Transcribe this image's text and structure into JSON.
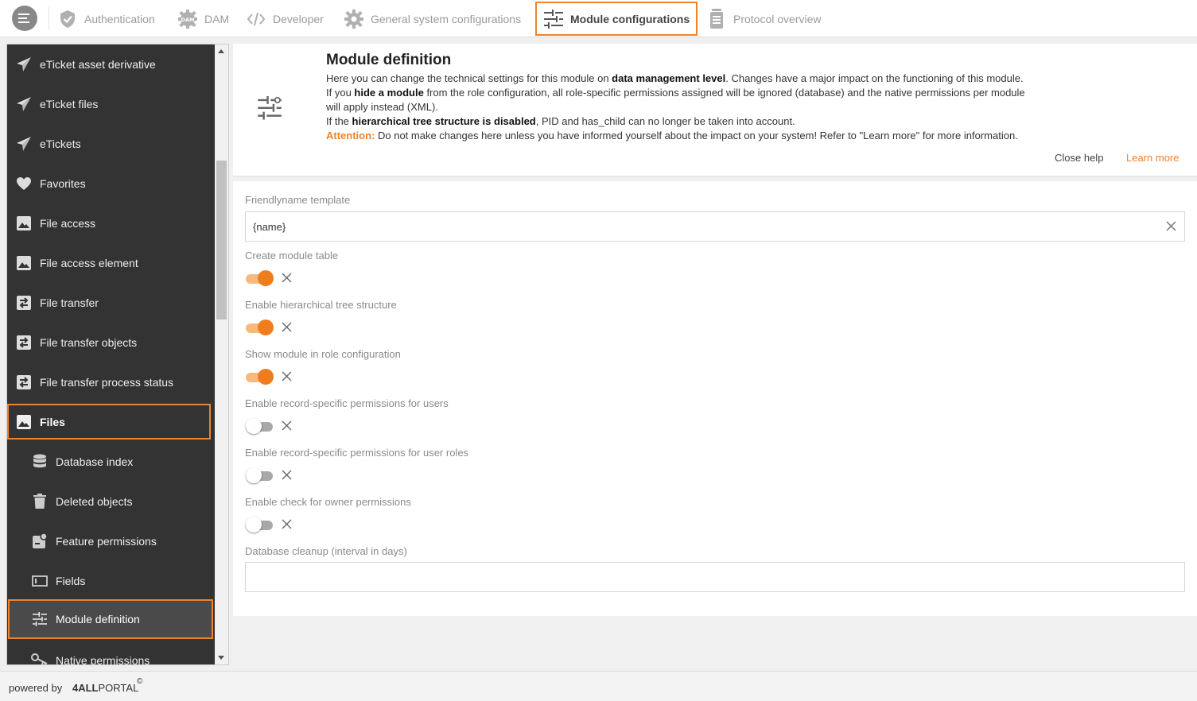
{
  "topbar": {
    "tabs": [
      {
        "label": "Authentication",
        "icon": "shield-check-icon"
      },
      {
        "label": "DAM",
        "icon": "dam-gear-icon"
      },
      {
        "label": "Developer",
        "icon": "code-icon"
      },
      {
        "label": "General system configurations",
        "icon": "gear-icon"
      },
      {
        "label": "Module configurations",
        "icon": "sliders-icon",
        "active": true
      },
      {
        "label": "Protocol overview",
        "icon": "document-stack-icon"
      }
    ]
  },
  "sidebar": {
    "items": [
      {
        "label": "eTicket asset derivative",
        "icon": "paper-plane-icon"
      },
      {
        "label": "eTicket files",
        "icon": "paper-plane-icon"
      },
      {
        "label": "eTickets",
        "icon": "paper-plane-icon"
      },
      {
        "label": "Favorites",
        "icon": "heart-icon"
      },
      {
        "label": "File access",
        "icon": "image-icon"
      },
      {
        "label": "File access element",
        "icon": "image-icon"
      },
      {
        "label": "File transfer",
        "icon": "transfer-icon"
      },
      {
        "label": "File transfer objects",
        "icon": "transfer-icon"
      },
      {
        "label": "File transfer process status",
        "icon": "transfer-icon"
      },
      {
        "label": "Files",
        "icon": "image-icon",
        "highlighted": true
      },
      {
        "label": "Database index",
        "icon": "database-icon",
        "sub": true
      },
      {
        "label": "Deleted objects",
        "icon": "trash-icon",
        "sub": true
      },
      {
        "label": "Feature permissions",
        "icon": "feature-permissions-icon",
        "sub": true
      },
      {
        "label": "Fields",
        "icon": "fields-icon",
        "sub": true
      },
      {
        "label": "Module definition",
        "icon": "sliders-icon",
        "sub": true,
        "selected": true
      },
      {
        "label": "Native permissions",
        "icon": "key-icon",
        "sub": true
      }
    ]
  },
  "help": {
    "title": "Module definition",
    "line1_a": "Here you can change the technical settings for this module on ",
    "line1_b": "data management level",
    "line1_c": ". Changes have a major impact on the functioning of this module.",
    "line2_a": "If you ",
    "line2_b": "hide a module",
    "line2_c": " from the role configuration, all role-specific permissions assigned will be ignored (database) and the native permissions per module will apply instead (XML).",
    "line3_a": "If the ",
    "line3_b": "hierarchical tree structure is disabled",
    "line3_c": ", PID and has_child can no longer be taken into account.",
    "attention_label": "Attention:",
    "attention_text": " Do not make changes here unless you have informed yourself about the impact on your system! Refer to \"Learn more\" for more information.",
    "close_label": "Close help",
    "learn_more_label": "Learn more"
  },
  "form": {
    "friendlyname_label": "Friendlyname template",
    "friendlyname_value": "{name}",
    "toggles": [
      {
        "label": "Create module table",
        "on": true
      },
      {
        "label": "Enable hierarchical tree structure",
        "on": true
      },
      {
        "label": "Show module in role configuration",
        "on": true
      },
      {
        "label": "Enable record-specific permissions for users",
        "on": false
      },
      {
        "label": "Enable record-specific permissions for user roles",
        "on": false
      },
      {
        "label": "Enable check for owner permissions",
        "on": false
      }
    ],
    "cleanup_label": "Database cleanup (interval in days)",
    "cleanup_value": ""
  },
  "footer": {
    "powered_by": "powered by",
    "brand_bold": "4ALL",
    "brand_rest": "PORTAL",
    "copyright": "©"
  },
  "colors": {
    "accent": "#f0822a",
    "sidebar_bg": "#333333",
    "toggle_on": "#f07d1d"
  }
}
